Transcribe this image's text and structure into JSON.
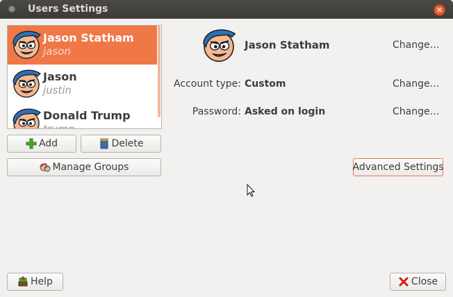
{
  "window": {
    "title": "Users Settings"
  },
  "users": [
    {
      "name": "Jason Statham",
      "login": "jason",
      "selected": true
    },
    {
      "name": "Jason",
      "login": "justin",
      "selected": false
    },
    {
      "name": "Donald Trump",
      "login": "trump",
      "selected": false
    }
  ],
  "buttons": {
    "add": "Add",
    "delete": "Delete",
    "manage_groups": "Manage Groups",
    "advanced_settings": "Advanced Settings",
    "help": "Help",
    "close": "Close"
  },
  "details": {
    "name": "Jason Statham",
    "account_type_label": "Account type:",
    "account_type_value": "Custom",
    "password_label": "Password:",
    "password_value": "Asked on login",
    "change_label": "Change…"
  },
  "colors": {
    "selection": "#f07746",
    "titlebar": "#3c3b37",
    "focus_border": "#e0795a"
  },
  "icons": {
    "add": "plus-icon",
    "delete": "trash-can-icon",
    "manage_groups": "group-icon",
    "help": "help-book-icon",
    "close": "red-x-icon"
  }
}
